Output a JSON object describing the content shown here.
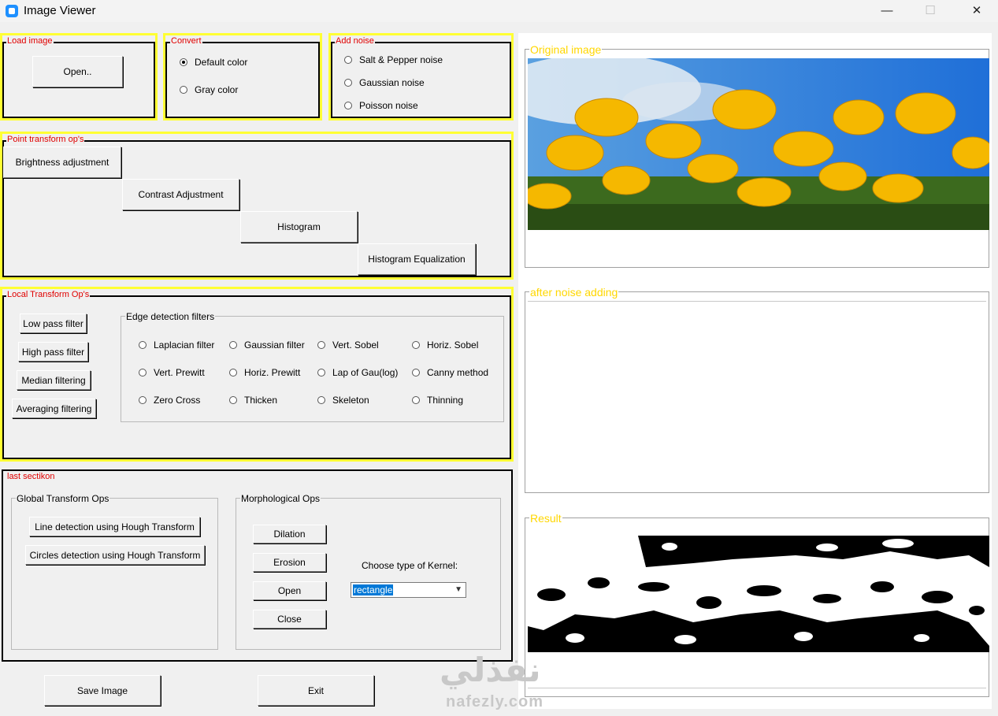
{
  "window": {
    "title": "Image Viewer",
    "minimize": "—",
    "maximize": "☐",
    "close": "✕"
  },
  "load_image": {
    "legend": "Load image",
    "open_button": "Open.."
  },
  "convert": {
    "legend": "Convert",
    "options": [
      "Default color",
      "Gray color"
    ],
    "selected": "Default color"
  },
  "add_noise": {
    "legend": "Add noise",
    "options": [
      "Salt & Pepper noise",
      "Gaussian noise",
      "Poisson noise"
    ]
  },
  "point_transform": {
    "legend": "Point transform op's",
    "buttons": [
      "Brightness adjustment",
      "Contrast Adjustment",
      "Histogram",
      "Histogram Equalization"
    ]
  },
  "local_transform": {
    "legend": "Local Transform Op's",
    "buttons": [
      "Low pass filter",
      "High pass filter",
      "Median filtering",
      "Averaging filtering"
    ],
    "edge_group_legend": "Edge detection filters",
    "edge_filters": [
      "Laplacian filter",
      "Gaussian filter",
      "Vert. Sobel",
      "Horiz. Sobel",
      "Vert. Prewitt",
      "Horiz. Prewitt",
      "Lap of Gau(log)",
      "Canny method",
      "Zero Cross",
      "Thicken",
      "Skeleton",
      "Thinning"
    ]
  },
  "last_section": {
    "legend": "last sectikon",
    "global_group_legend": "Global Transform Ops",
    "global_buttons": [
      "Line detection using Hough Transform",
      "Circles detection using Hough Transform"
    ],
    "morph_group_legend": "Morphological Ops",
    "morph_buttons": [
      "Dilation",
      "Erosion",
      "Open",
      "Close"
    ],
    "kernel_label": "Choose type of Kernel:",
    "kernel_value": "rectangle"
  },
  "bottom": {
    "save_button": "Save Image",
    "exit_button": "Exit"
  },
  "panels": {
    "original": "Original image",
    "noise": "after noise adding",
    "result": "Result"
  },
  "watermark": {
    "arabic": "نفذلي",
    "latin": "nafezly.com"
  },
  "colors": {
    "frame_yellow": "#ffff33",
    "legend_red": "#e00000",
    "panel_gold": "#ffd700",
    "selection_blue": "#0078d7"
  }
}
